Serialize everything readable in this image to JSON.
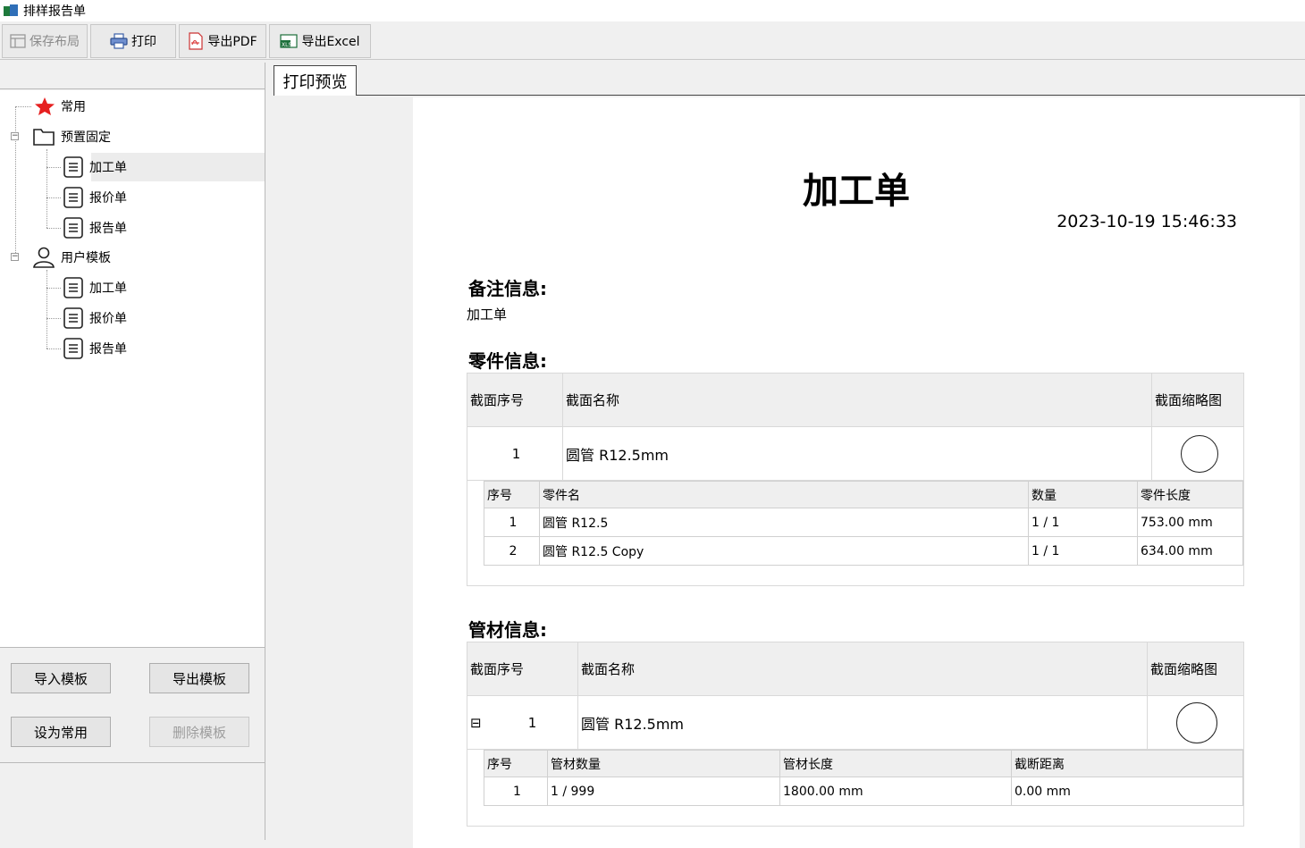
{
  "window": {
    "title": "排样报告单"
  },
  "toolbar": {
    "save_layout": "保存布局",
    "print": "打印",
    "export_pdf": "导出PDF",
    "export_excel": "导出Excel"
  },
  "tree": {
    "common": "常用",
    "preset": "预置固定",
    "preset_items": [
      "加工单",
      "报价单",
      "报告单"
    ],
    "user": "用户模板",
    "user_items": [
      "加工单",
      "报价单",
      "报告单"
    ]
  },
  "buttons": {
    "import": "导入模板",
    "export": "导出模板",
    "set_common": "设为常用",
    "delete": "删除模板"
  },
  "tab": {
    "label": "打印预览"
  },
  "doc": {
    "title": "加工单",
    "date": "2023-10-19 15:46:33",
    "remark_title": "备注信息:",
    "remark_value": "加工单",
    "parts_title": "零件信息:",
    "pipe_title": "管材信息:",
    "parts": {
      "headers": [
        "截面序号",
        "截面名称",
        "截面缩略图"
      ],
      "row": {
        "index": "1",
        "name": "圆管 R12.5mm"
      },
      "sub_headers": [
        "序号",
        "零件名",
        "数量",
        "零件长度"
      ],
      "sub_rows": [
        [
          "1",
          "圆管 R12.5",
          "1 / 1",
          "753.00 mm"
        ],
        [
          "2",
          "圆管 R12.5 Copy",
          "1 / 1",
          "634.00 mm"
        ]
      ]
    },
    "pipe": {
      "headers": [
        "截面序号",
        "截面名称",
        "截面缩略图"
      ],
      "row": {
        "collapse": "⊟",
        "index": "1",
        "name": "圆管 R12.5mm"
      },
      "sub_headers": [
        "序号",
        "管材数量",
        "管材长度",
        "截断距离"
      ],
      "sub_rows": [
        [
          "1",
          "1 / 999",
          "1800.00 mm",
          "0.00 mm"
        ]
      ]
    }
  }
}
